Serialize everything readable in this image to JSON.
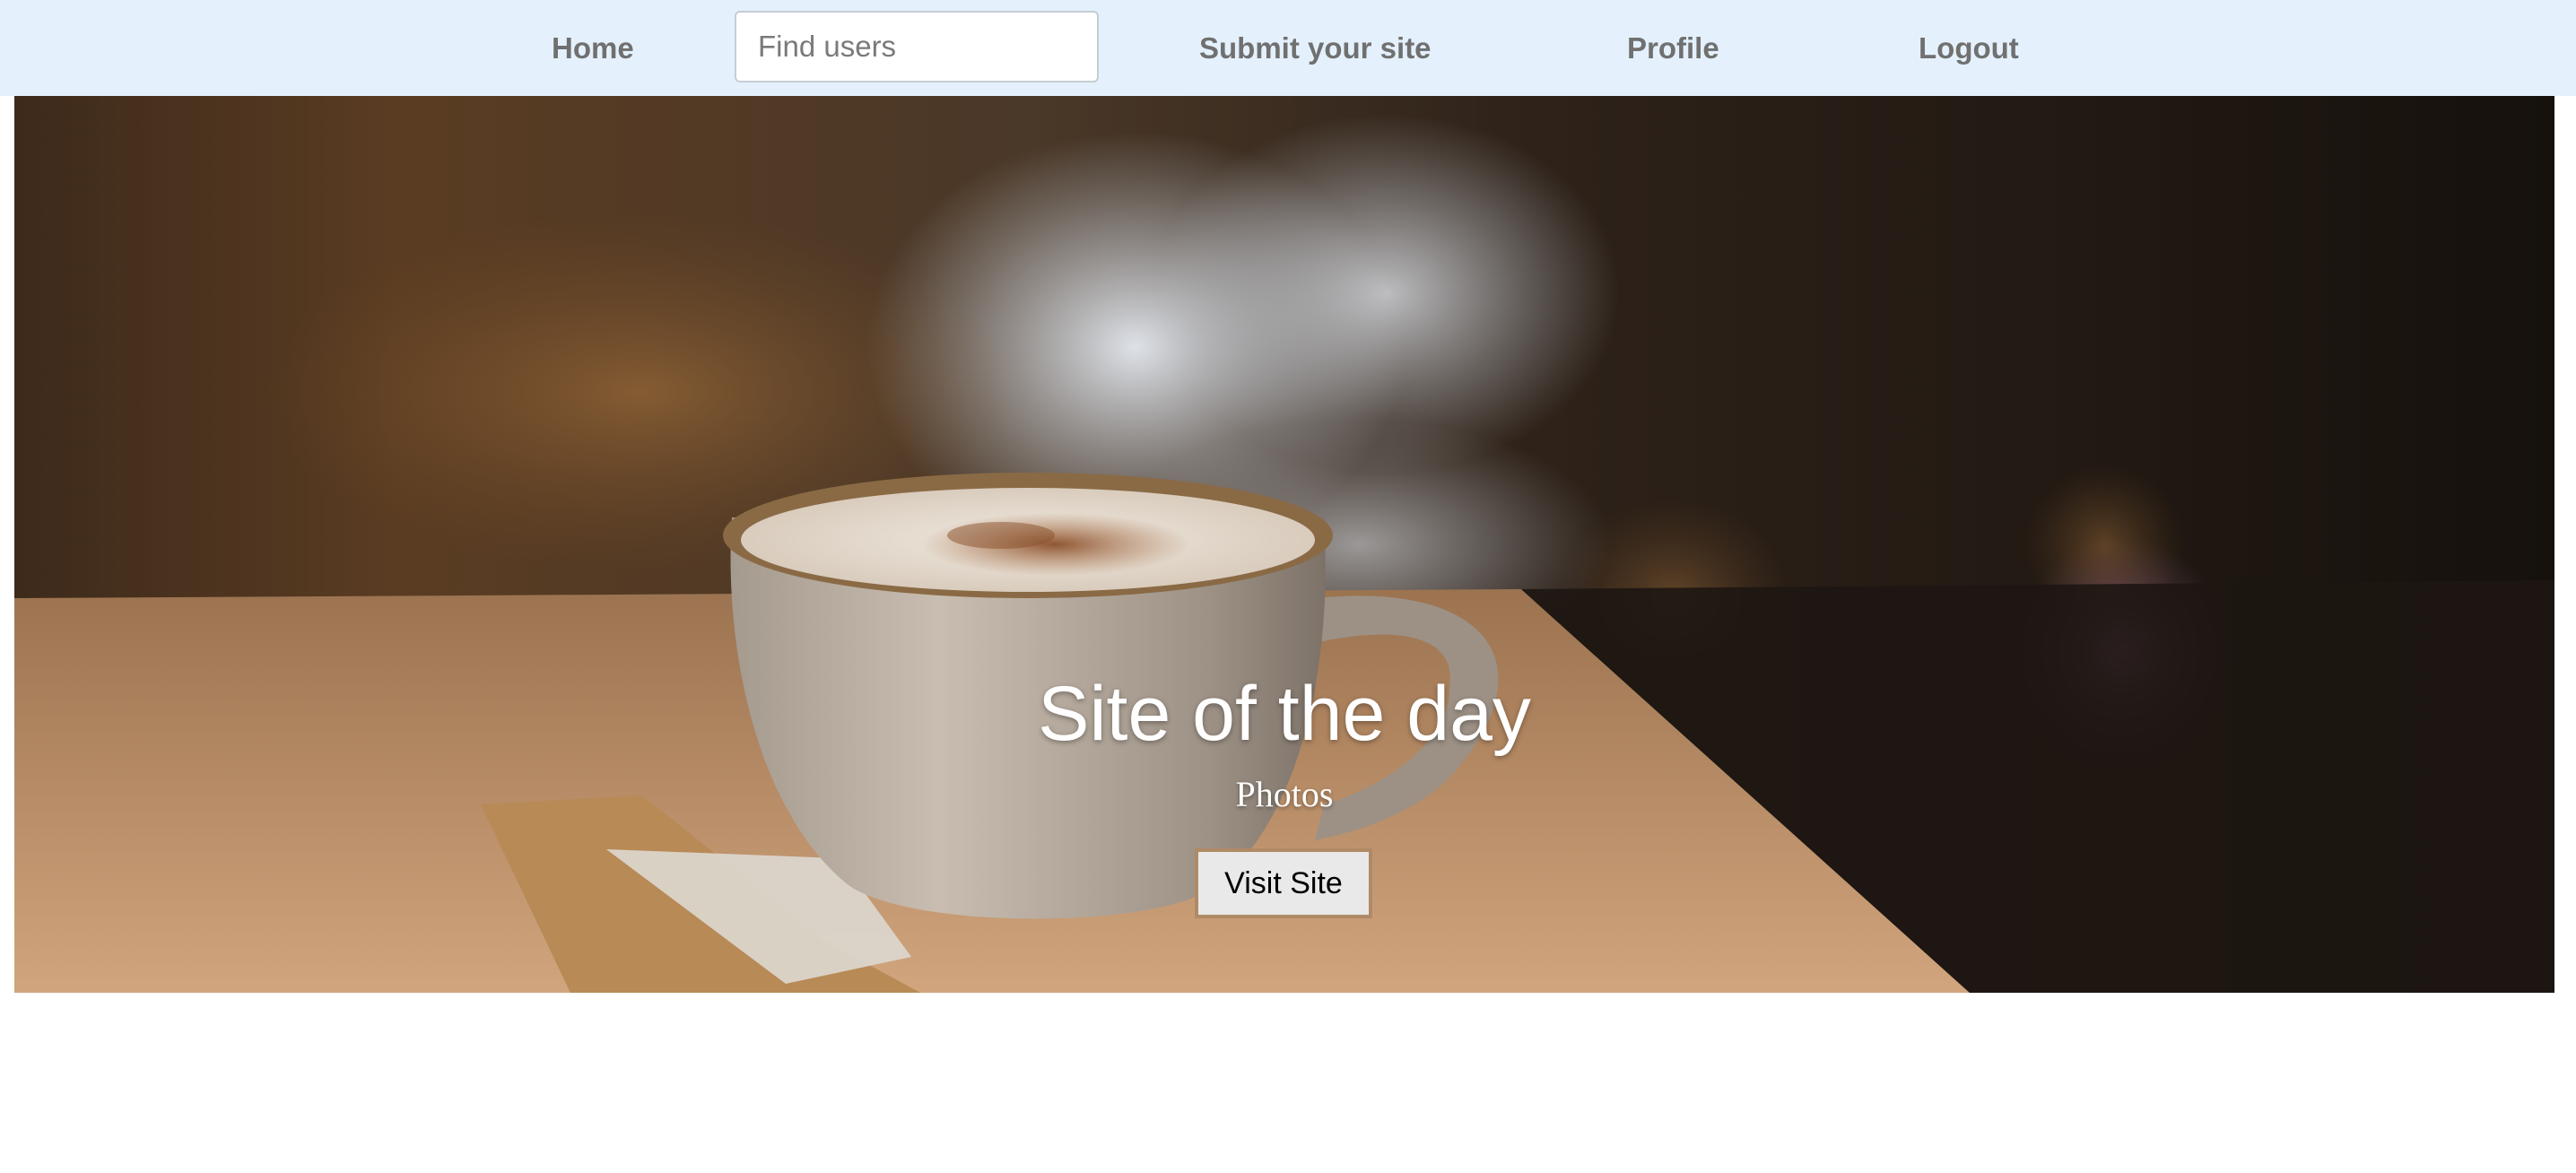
{
  "nav": {
    "home_label": "Home",
    "search_placeholder": "Find users",
    "search_value": "",
    "submit_label": "Submit your site",
    "profile_label": "Profile",
    "logout_label": "Logout"
  },
  "hero": {
    "title": "Site of the day",
    "subtitle": "Photos",
    "button_label": "Visit Site",
    "image_subject": "cup of cappuccino on a saucer on a wooden cafe table"
  },
  "colors": {
    "navbar_background": "#e4f1fc",
    "nav_text": "#707070",
    "hero_text": "#ffffff",
    "button_border": "#b08a66",
    "button_background": "#e9e9e9"
  }
}
